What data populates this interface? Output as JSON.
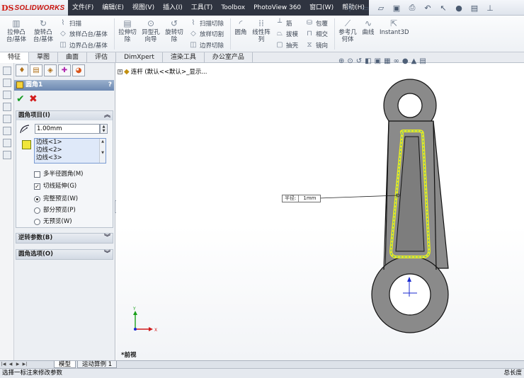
{
  "app": {
    "logo_mark": "DS",
    "logo_text": "SOLIDWORKS"
  },
  "menu": [
    "文件(F)",
    "编辑(E)",
    "视图(V)",
    "插入(I)",
    "工具(T)",
    "Toolbox",
    "PhotoView 360",
    "窗口(W)",
    "帮助(H)"
  ],
  "quick_access_icons": [
    "pin-icon",
    "new-document-icon",
    "open-icon",
    "save-icon",
    "print-icon",
    "undo-icon",
    "select-icon",
    "rebuild-icon",
    "options-icon",
    "pushpin-icon"
  ],
  "ribbon": {
    "extrude_boss": "拉伸凸\n台/基体",
    "revolve_boss": "旋转凸\n台/基体",
    "sweep": "扫描",
    "loft_boss": "放样凸台/基体",
    "boundary_boss": "边界凸台/基体",
    "extrude_cut": "拉伸切\n除",
    "hole_wizard": "异型孔\n向导",
    "revolve_cut": "旋转切\n除",
    "swept_cut": "扫描切除",
    "lofted_cut": "放样切割",
    "boundary_cut": "边界切除",
    "fillet": "圆角",
    "linear_pattern": "线性阵\n列",
    "rib": "筋",
    "draft": "拔模",
    "shell": "抽壳",
    "wrap": "包覆",
    "intersect": "相交",
    "mirror": "镜向",
    "ref_geometry": "参考几\n何体",
    "curves": "曲线",
    "instant3d": "Instant3D"
  },
  "command_tabs": [
    "特征",
    "草图",
    "曲面",
    "评估",
    "DimXpert",
    "渲染工具",
    "办公室产品"
  ],
  "active_command_tab": 0,
  "property_manager": {
    "title": "圆角1",
    "help": "?",
    "tab_icons": [
      "feature-manager-icon",
      "property-manager-icon",
      "configuration-manager-icon",
      "dimxpert-manager-icon",
      "display-manager-icon"
    ],
    "fillet_items_header": "圆角项目(I)",
    "radius_value": "1.00mm",
    "edges": [
      "边线<1>",
      "边线<2>",
      "边线<3>"
    ],
    "multi_radius_label": "多半径圆角(M)",
    "multi_radius_checked": false,
    "tangent_propagation_label": "切线延伸(G)",
    "tangent_propagation_checked": true,
    "preview_options": [
      {
        "label": "完整预览(W)",
        "selected": true
      },
      {
        "label": "部分预览(P)",
        "selected": false
      },
      {
        "label": "无预览(W)",
        "selected": false
      }
    ],
    "setback_header": "逆转参数(B)",
    "fillet_options_header": "圆角选项(O)"
  },
  "graphics": {
    "tree_label": "连杆  (默认<<默认>_显示...",
    "radius_callout_label": "半径:",
    "radius_callout_value": "1mm",
    "view_label": "*前视",
    "axis_x": "X",
    "axis_y": "Y"
  },
  "bottom_tabs": [
    "模型",
    "运动算例 1"
  ],
  "active_bottom_tab": 0,
  "status": {
    "left": "选择一标注来修改参数",
    "right": "总长度"
  },
  "colors": {
    "part_fill": "#8a8a8a",
    "edge_highlight": "#e9ec1e",
    "preview_dash": "#3a8fd9",
    "title_bar_menu": "#2f3440",
    "pm_title": "#7a93b8"
  }
}
